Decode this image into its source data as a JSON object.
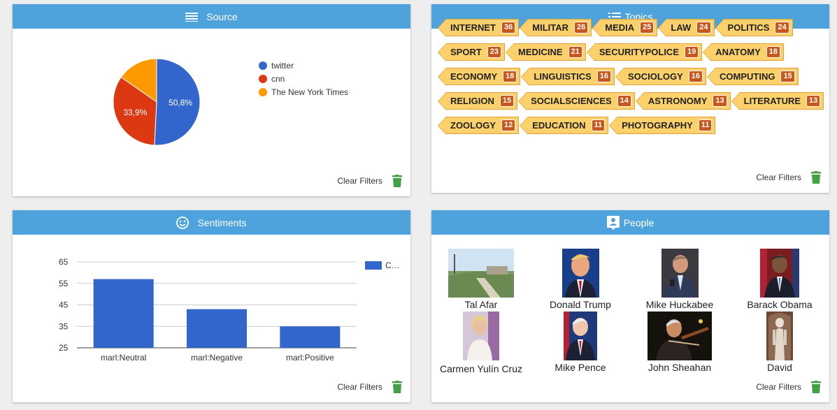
{
  "source": {
    "title": "Source",
    "clear_label": "Clear Filters",
    "legend": [
      {
        "label": "twitter",
        "color": "#3366cc"
      },
      {
        "label": "cnn",
        "color": "#dc3912"
      },
      {
        "label": "The New York Times",
        "color": "#ff9900"
      }
    ],
    "chart_data": {
      "type": "pie",
      "slices": [
        {
          "label": "twitter",
          "value": 50.8,
          "color": "#3366cc",
          "text": "50,8%"
        },
        {
          "label": "cnn",
          "value": 33.9,
          "color": "#dc3912",
          "text": "33,9%"
        },
        {
          "label": "The New York Times",
          "value": 15.3,
          "color": "#ff9900",
          "text": ""
        }
      ]
    }
  },
  "topics": {
    "title": "Topics",
    "clear_label": "Clear Filters",
    "rows": [
      [
        {
          "label": "INTERNET",
          "count": "36"
        },
        {
          "label": "MILITAR",
          "count": "26"
        },
        {
          "label": "MEDIA",
          "count": "25"
        },
        {
          "label": "LAW",
          "count": "24"
        },
        {
          "label": "POLITICS",
          "count": "24"
        }
      ],
      [
        {
          "label": "SPORT",
          "count": "23"
        },
        {
          "label": "MEDICINE",
          "count": "21"
        },
        {
          "label": "SECURITYPOLICE",
          "count": "19"
        },
        {
          "label": "ANATOMY",
          "count": "18"
        }
      ],
      [
        {
          "label": "ECONOMY",
          "count": "18"
        },
        {
          "label": "LINGUISTICS",
          "count": "16"
        },
        {
          "label": "SOCIOLOGY",
          "count": "16"
        },
        {
          "label": "COMPUTING",
          "count": "15"
        }
      ],
      [
        {
          "label": "RELIGION",
          "count": "15"
        },
        {
          "label": "SOCIALSCIENCES",
          "count": "14"
        },
        {
          "label": "ASTRONOMY",
          "count": "13"
        },
        {
          "label": "LITERATURE",
          "count": "13"
        }
      ],
      [
        {
          "label": "ZOOLOGY",
          "count": "12"
        },
        {
          "label": "EDUCATION",
          "count": "11"
        },
        {
          "label": "PHOTOGRAPHY",
          "count": "11"
        }
      ]
    ]
  },
  "sentiments": {
    "title": "Sentiments",
    "clear_label": "Clear Filters",
    "legend_label": "C…",
    "chart_data": {
      "type": "bar",
      "categories": [
        "marl:Neutral",
        "marl:Negative",
        "marl:Positive"
      ],
      "series": [
        {
          "name": "C…",
          "values": [
            57,
            43,
            35
          ],
          "color": "#3366cc"
        }
      ],
      "yticks": [
        25,
        35,
        45,
        55,
        65
      ],
      "ylim": [
        25,
        65
      ],
      "grid": true,
      "legend": "top-right"
    }
  },
  "people": {
    "title": "People",
    "clear_label": "Clear Filters",
    "items": [
      {
        "name": "Tal Afar"
      },
      {
        "name": "Donald Trump"
      },
      {
        "name": "Mike Huckabee"
      },
      {
        "name": "Barack Obama"
      },
      {
        "name": "Carmen Yulín Cruz"
      },
      {
        "name": "Mike Pence"
      },
      {
        "name": "John Sheahan"
      },
      {
        "name": "David"
      }
    ]
  }
}
